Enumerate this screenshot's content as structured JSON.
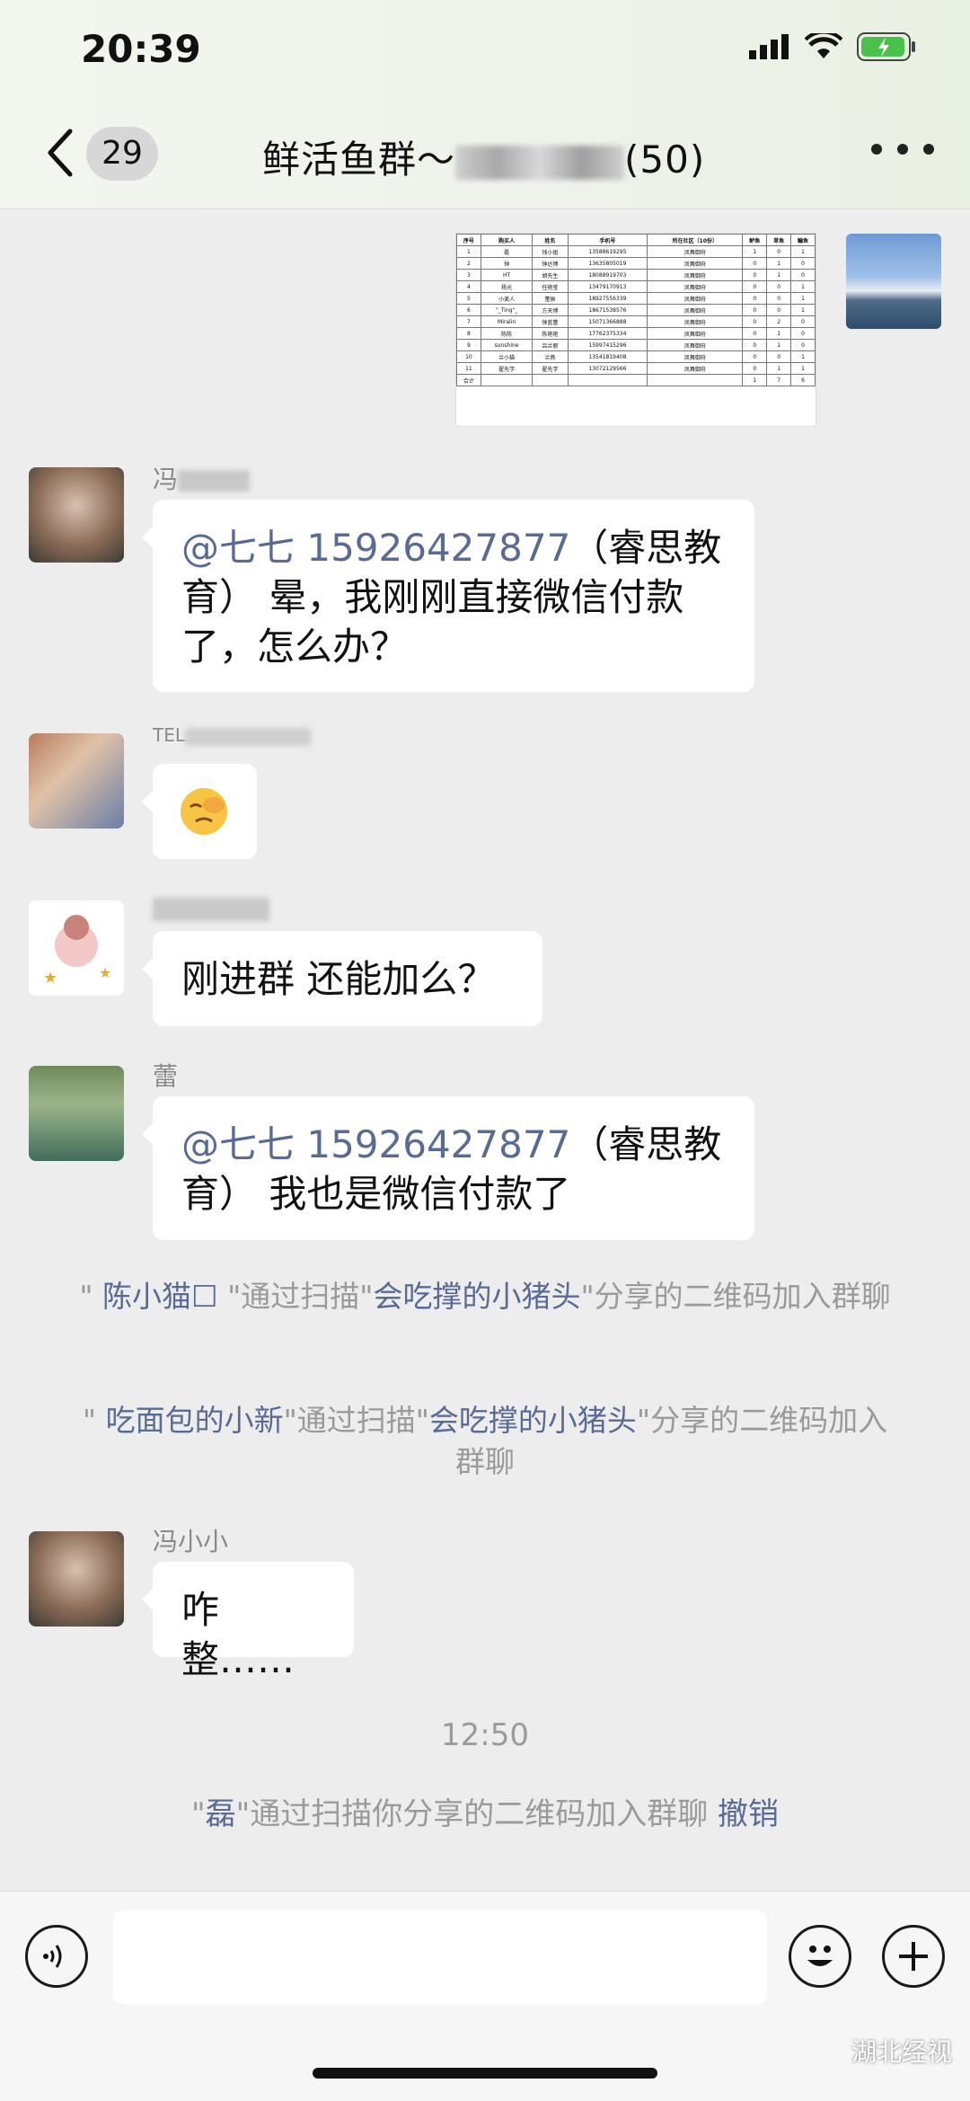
{
  "status": {
    "time": "20:39"
  },
  "header": {
    "back_count": "29",
    "title_prefix": "鲜活鱼群～",
    "title_suffix": "(50)"
  },
  "sheet": {
    "headers": [
      "序号",
      "购买人",
      "姓名",
      "手机号",
      "所在社区（10份）",
      "鲈鱼",
      "草鱼",
      "鳊鱼"
    ],
    "rows": [
      [
        "1",
        "磊",
        "钱小姐",
        "13588619295",
        "凤舞御府",
        "1",
        "0",
        "1"
      ],
      [
        "2",
        "钟",
        "钟达博",
        "13635805019",
        "凤舞御府",
        "0",
        "1",
        "0"
      ],
      [
        "3",
        "HT",
        "胡先生",
        "18088919703",
        "凤舞御府",
        "0",
        "1",
        "0"
      ],
      [
        "4",
        "杨光",
        "任艳莹",
        "13479170913",
        "凤舞御府",
        "0",
        "0",
        "1"
      ],
      [
        "5",
        "小美人",
        "董振",
        "18927556339",
        "凤舞御府",
        "0",
        "0",
        "1"
      ],
      [
        "6",
        "\"_Ting\"_",
        "方天博",
        "18671538576",
        "凤舞御府",
        "0",
        "0",
        "1"
      ],
      [
        "7",
        "Miralin",
        "钟蓝蕾",
        "15071366888",
        "凤舞御府",
        "0",
        "2",
        "0"
      ],
      [
        "8",
        "陈陈",
        "陈艳艳",
        "17762375334",
        "凤舞御府",
        "0",
        "1",
        "0"
      ],
      [
        "9",
        "sunshine",
        "吕兰丽",
        "15997415296",
        "凤舞御府",
        "0",
        "1",
        "0"
      ],
      [
        "10",
        "兰小猫",
        "兰燕",
        "13541819408",
        "凤舞御府",
        "0",
        "0",
        "1"
      ],
      [
        "11",
        "翟先学",
        "翟先学",
        "13072129566",
        "凤舞御府",
        "0",
        "1",
        "1"
      ]
    ],
    "total": [
      "合计",
      "",
      "",
      "",
      "",
      "1",
      "7",
      "6"
    ]
  },
  "messages": {
    "m1": {
      "nick": "冯",
      "mention": "@七七 15926427877",
      "text": "（睿思教育） 晕，我刚刚直接微信付款了，怎么办？"
    },
    "m2": {
      "nick": "TEL"
    },
    "m3": {
      "text": "刚进群 还能加么？"
    },
    "m4": {
      "nick": "蕾",
      "mention": "@七七 15926427877",
      "text": "（睿思教育） 我也是微信付款了"
    },
    "m5": {
      "nick": "冯小小",
      "text": "咋整……"
    }
  },
  "system": {
    "s1": {
      "q1": "\" ",
      "name": "陈小猫☐",
      "mid": " \"通过扫描\"",
      "inviter": "会吃撑的小猪头",
      "tail": "\"分享的二维码加入群聊"
    },
    "s2": {
      "q1": "\" ",
      "name": "吃面包的小新",
      "mid": "\"通过扫描\"",
      "inviter": "会吃撑的小猪头",
      "tail": "\"分享的二维码加入群聊"
    },
    "time": "12:50",
    "s3": {
      "q1": "\"",
      "name": "磊",
      "mid": "\"通过扫描你分享的二维码加入群聊",
      "action": "撤销"
    }
  },
  "watermark": "湖北经视"
}
